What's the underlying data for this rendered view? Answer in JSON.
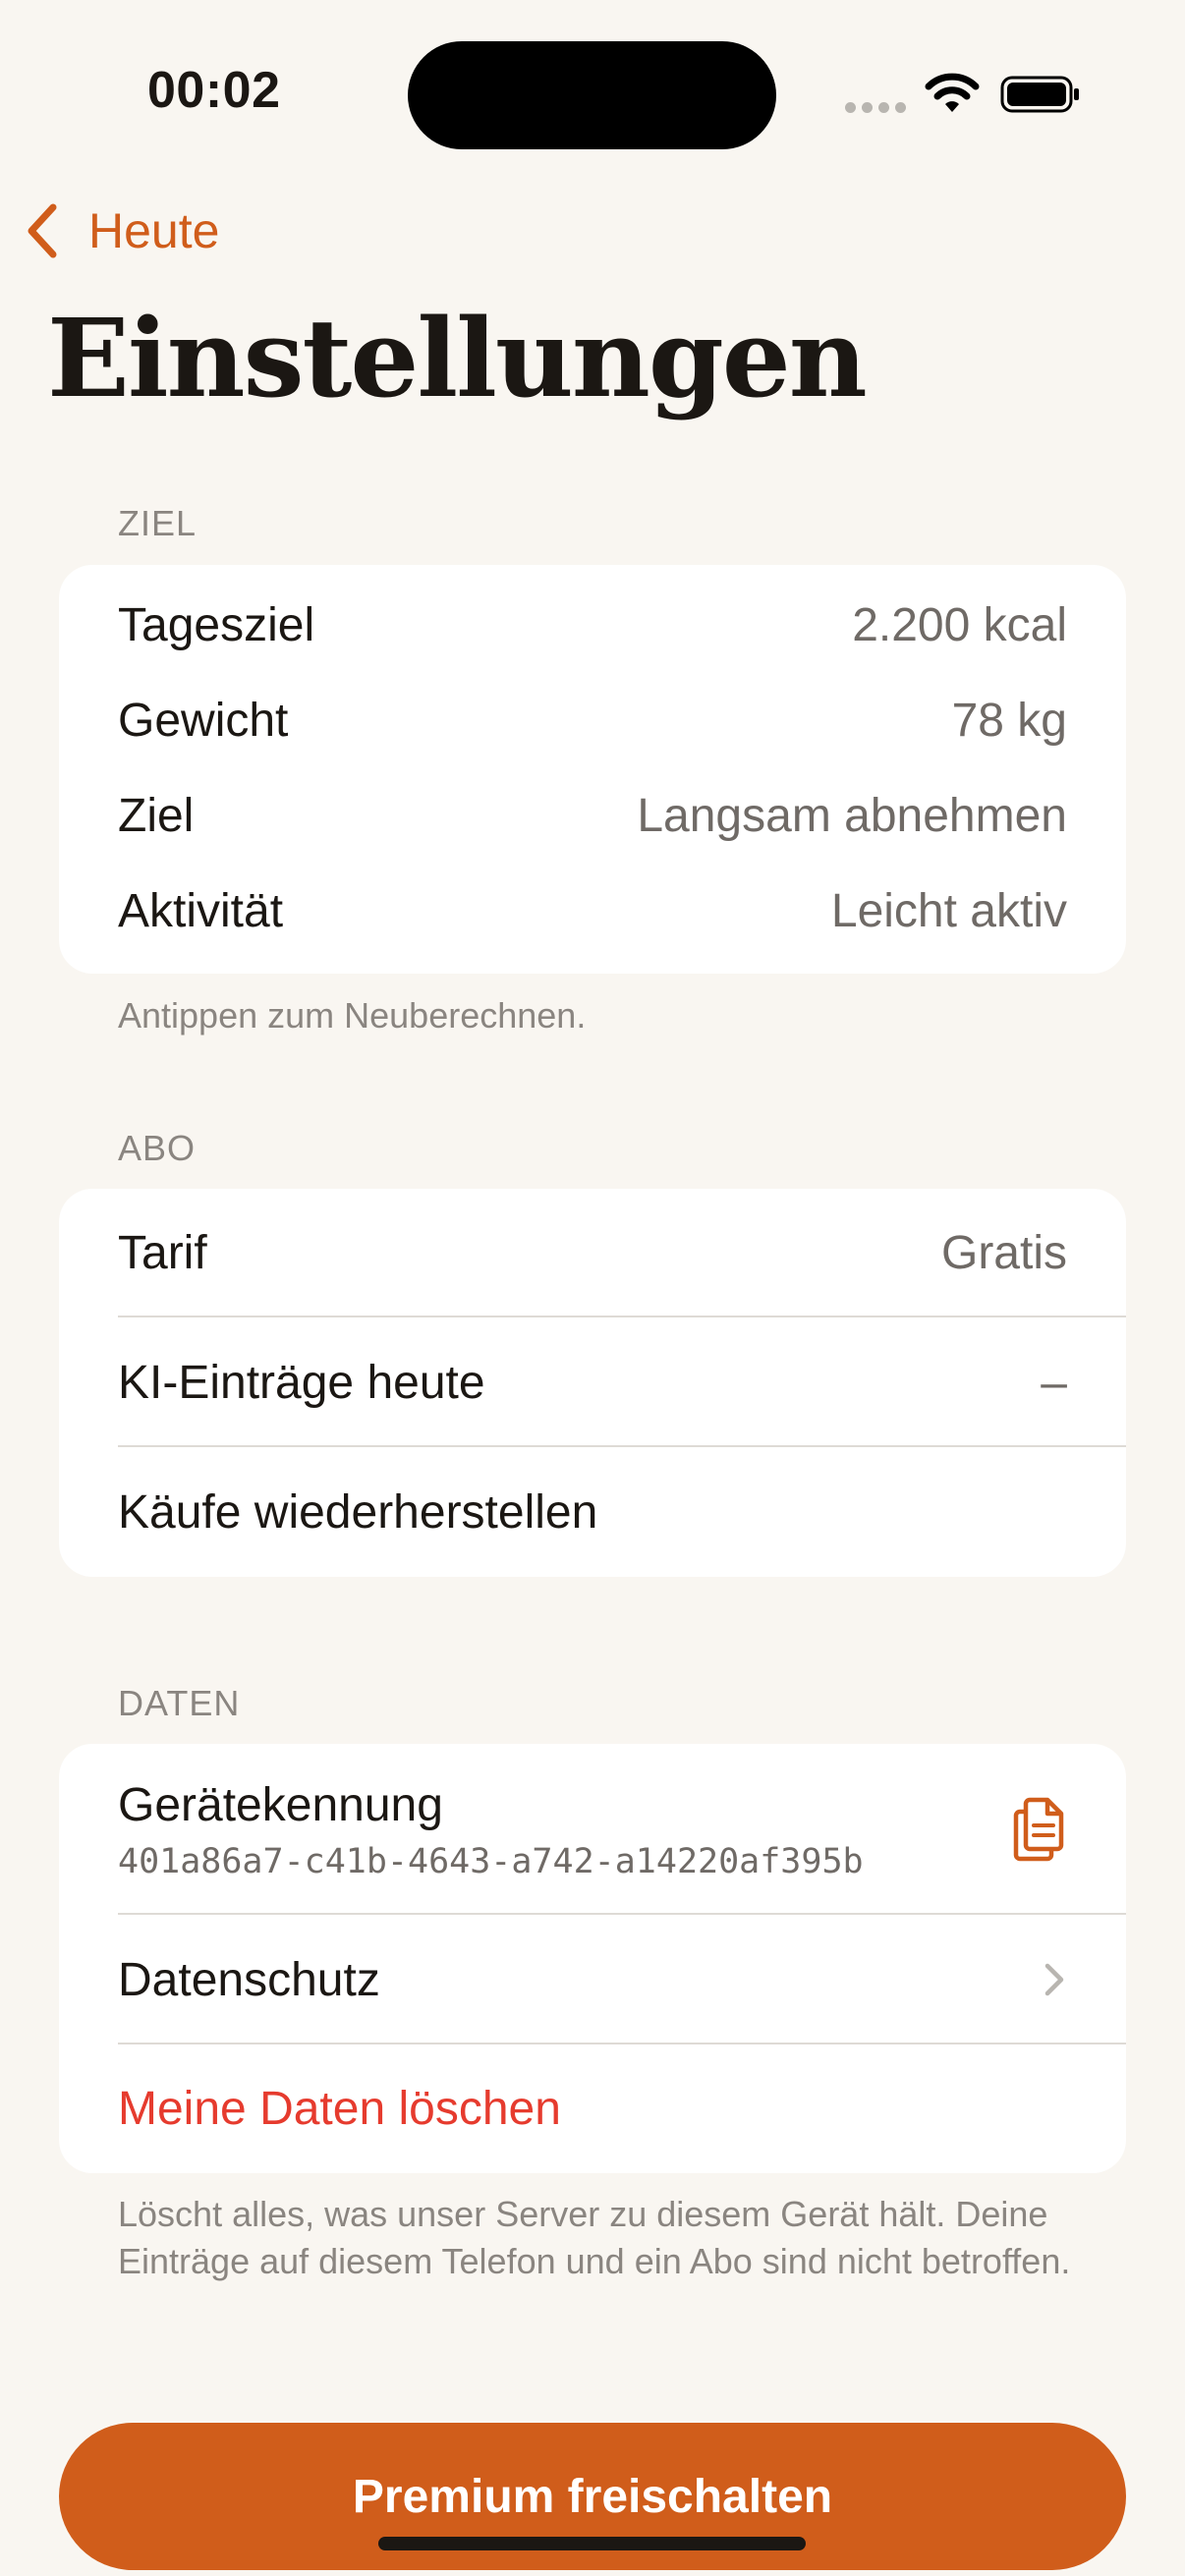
{
  "status_bar": {
    "time": "00:02"
  },
  "nav": {
    "back_label": "Heute",
    "title": "Einstellungen"
  },
  "ziel": {
    "header": "ZIEL",
    "rows": [
      {
        "label": "Tagesziel",
        "value": "2.200 kcal"
      },
      {
        "label": "Gewicht",
        "value": "78 kg"
      },
      {
        "label": "Ziel",
        "value": "Langsam abnehmen"
      },
      {
        "label": "Aktivität",
        "value": "Leicht aktiv"
      }
    ],
    "footer": "Antippen zum Neuberechnen."
  },
  "abo": {
    "header": "ABO",
    "tarif_label": "Tarif",
    "tarif_value": "Gratis",
    "ki_label": "KI-Einträge heute",
    "ki_value": "–",
    "restore_label": "Käufe wiederherstellen"
  },
  "daten": {
    "header": "DATEN",
    "device_label": "Gerätekennung",
    "device_id": "401a86a7-c41b-4643-a742-a14220af395b",
    "privacy_label": "Datenschutz",
    "delete_label": "Meine Daten löschen",
    "footer": "Löscht alles, was unser Server zu diesem Gerät hält. Deine Einträge auf diesem Telefon und ein Abo sind nicht betroffen."
  },
  "premium_button": "Premium freischalten",
  "colors": {
    "accent": "#d05d1b",
    "danger": "#e63b2e",
    "background": "#f9f6f1"
  },
  "icons": [
    "chevron-left-icon",
    "wifi-icon",
    "battery-icon",
    "copy-icon",
    "chevron-right-icon"
  ]
}
